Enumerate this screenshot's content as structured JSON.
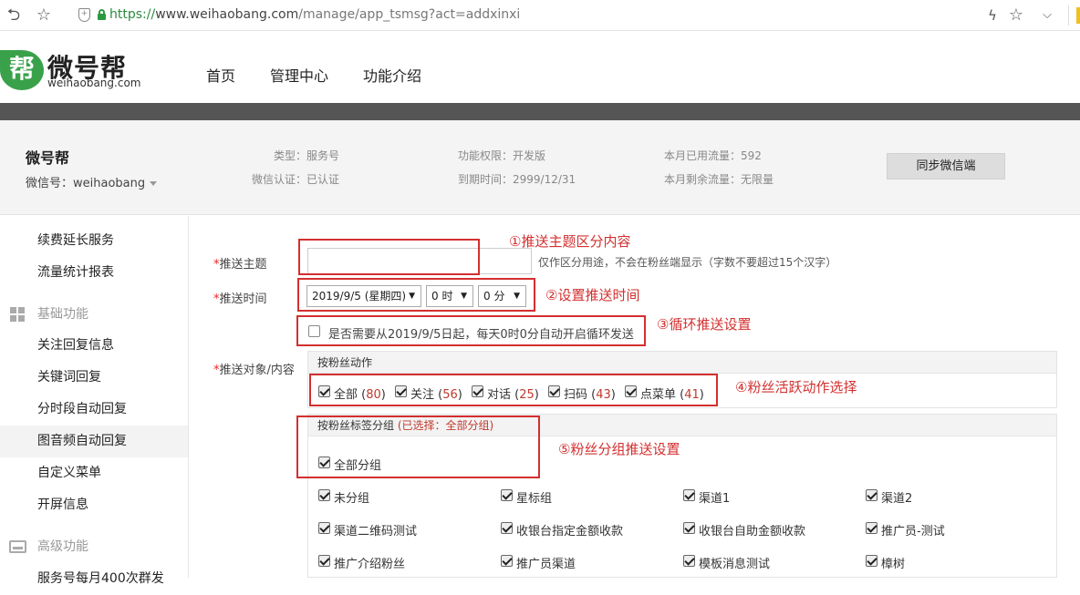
{
  "browser": {
    "url_scheme": "https://",
    "url_host": "www.weihaobang.com",
    "url_path": "/manage/app_tsmsg?act=addxinxi"
  },
  "site": {
    "logo_char": "帮",
    "name": "微号帮",
    "domain": "weihaobang.com",
    "nav": [
      "首页",
      "管理中心",
      "功能介绍"
    ]
  },
  "account": {
    "name": "微号帮",
    "wechat_id": "微信号：weihaobang",
    "type": "类型：服务号",
    "verified": "微信认证：已认证",
    "permission": "功能权限：开发版",
    "expire": "到期时间：2999/12/31",
    "used_traffic": "本月已用流量：592",
    "remaining_traffic": "本月剩余流量：无限量",
    "sync_button": "同步微信端"
  },
  "sidebar": {
    "items_top": [
      "续费延长服务",
      "流量统计报表"
    ],
    "group_basic": "基础功能",
    "items_basic": [
      "关注回复信息",
      "关键词回复",
      "分时段自动回复",
      "图音频自动回复",
      "自定义菜单",
      "开屏信息"
    ],
    "active_item": "图音频自动回复",
    "group_advanced": "高级功能",
    "items_advanced": [
      "服务号每月400次群发"
    ]
  },
  "form": {
    "required_mark": "*",
    "subject_label": "推送主题",
    "subject_value": "",
    "subject_hint": "仅作区分用途，不会在粉丝端显示（字数不要超过15个汉字）",
    "time_label": "推送时间",
    "date_value": "2019/9/5 (星期四)",
    "hour_value": "0 时",
    "minute_value": "0 分",
    "loop_text": "是否需要从2019/9/5日起，每天0时0分自动开启循环发送",
    "target_label": "推送对象/内容",
    "action_section_title": "按粉丝动作",
    "actions": [
      {
        "label": "全部",
        "count": "80"
      },
      {
        "label": "关注",
        "count": "56"
      },
      {
        "label": "对话",
        "count": "25"
      },
      {
        "label": "扫码",
        "count": "43"
      },
      {
        "label": "点菜单",
        "count": "41"
      }
    ],
    "tag_section_title": "按粉丝标签分组",
    "tag_selected_note": "(已选择：全部分组)",
    "all_groups": "全部分组",
    "groups": [
      "未分组",
      "星标组",
      "渠道1",
      "渠道2",
      "渠道二维码测试",
      "收银台指定金额收款",
      "收银台自助金额收款",
      "推广员-测试",
      "推广介绍粉丝",
      "推广员渠道",
      "模板消息测试",
      "樟树"
    ]
  },
  "annotations": {
    "note1": "①推送主题区分内容",
    "note2": "②设置推送时间",
    "note3": "③循环推送设置",
    "note4": "④粉丝活跃动作选择",
    "note5": "⑤粉丝分组推送设置"
  },
  "colors": {
    "brand_green": "#3aa14b",
    "annotation_red": "#d32f2f",
    "count_red": "#c0392b",
    "dark_band": "#555555"
  }
}
